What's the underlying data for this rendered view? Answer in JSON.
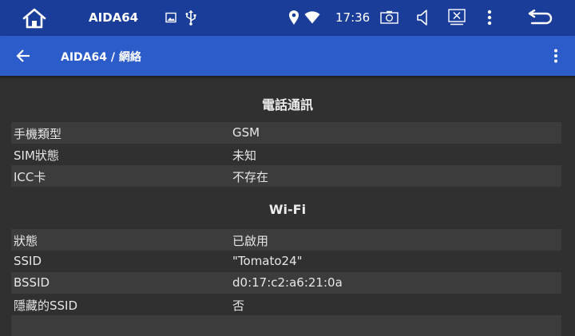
{
  "statusbar": {
    "app_name": "AIDA64",
    "time": "17:36",
    "icons": [
      "home-icon",
      "image-icon",
      "usb-icon",
      "location-icon",
      "wifi-icon",
      "screenshot-icon",
      "volume-icon",
      "close-window-icon",
      "more-vert-icon",
      "back-arrow-icon"
    ]
  },
  "toolbar": {
    "breadcrumb": "AIDA64 / 網絡",
    "icons": [
      "back-icon",
      "overflow-menu-icon"
    ]
  },
  "sections": [
    {
      "title": "電話通訊",
      "rows": [
        {
          "key": "手機類型",
          "value": "GSM"
        },
        {
          "key": "SIM狀態",
          "value": "未知"
        },
        {
          "key": "ICC卡",
          "value": "不存在"
        }
      ]
    },
    {
      "title": "Wi-Fi",
      "rows": [
        {
          "key": "狀態",
          "value": "已啟用"
        },
        {
          "key": "SSID",
          "value": "\"Tomato24\""
        },
        {
          "key": "BSSID",
          "value": "d0:17:c2:a6:21:0a"
        },
        {
          "key": "隱藏的SSID",
          "value": "否"
        }
      ]
    }
  ],
  "colors": {
    "statusbar": "#1b3d9a",
    "toolbar": "#2c5cc9",
    "background": "#303030",
    "stripe": "#3c3c3c"
  }
}
